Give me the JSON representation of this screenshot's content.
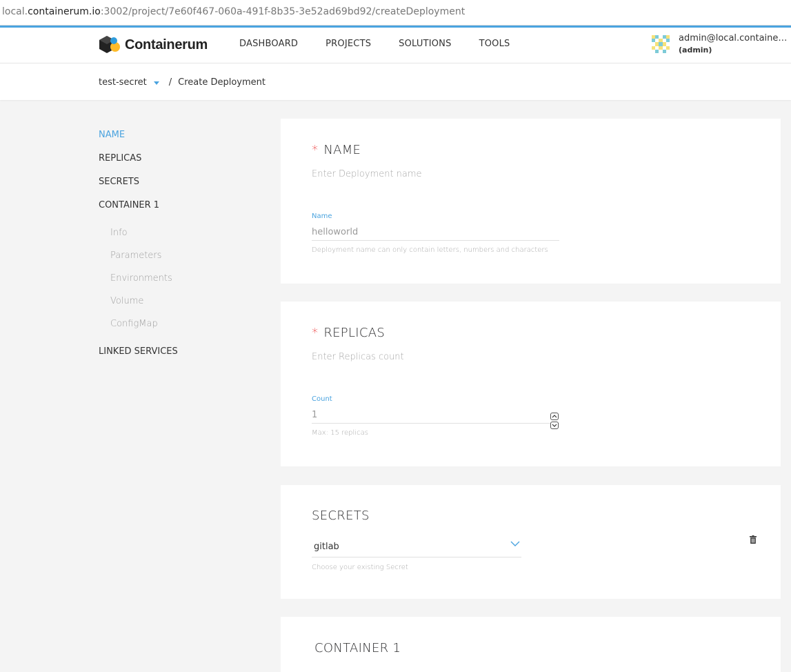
{
  "browser": {
    "url_prefix": "local.",
    "url_host": "containerum.io",
    "url_path": ":3002/project/7e60f467-060a-491f-8b35-3e52ad69bd92/createDeployment"
  },
  "header": {
    "logo_text": "Containerum",
    "nav": [
      "DASHBOARD",
      "PROJECTS",
      "SOLUTIONS",
      "TOOLS"
    ],
    "user_email": "admin@local.containerum.io",
    "user_role": "(admin)"
  },
  "breadcrumb": {
    "project": "test-secret",
    "separator": "/",
    "current": "Create Deployment"
  },
  "sidebar": {
    "items": [
      "NAME",
      "REPLICAS",
      "SECRETS",
      "CONTAINER 1"
    ],
    "container_sub": [
      "Info",
      "Parameters",
      "Environments",
      "Volume",
      "ConfigMap"
    ],
    "linked": "LINKED SERVICES",
    "active": "NAME"
  },
  "name_card": {
    "title": "NAME",
    "subtitle": "Enter Deployment name",
    "field_label": "Name",
    "field_value": "helloworld",
    "help": "Deployment name can only contain letters, numbers and characters"
  },
  "replicas_card": {
    "title": "REPLICAS",
    "subtitle": "Enter Replicas count",
    "field_label": "Count",
    "field_value": "1",
    "help": "Max: 15 replicas"
  },
  "secrets_card": {
    "title": "SECRETS",
    "selected": "gitlab",
    "help": "Choose your existing Secret"
  },
  "container_card": {
    "title": "CONTAINER 1"
  },
  "colors": {
    "accent": "#4aa3df",
    "required": "#ec3d3d",
    "background": "#f4f4f4"
  },
  "icons": {
    "logo": "hexagon-cube-logo",
    "avatar": "pixel-identicon",
    "caret": "caret-down-icon",
    "select": "chevron-down-icon",
    "delete": "trash-icon",
    "stepper_up": "chevron-up-icon",
    "stepper_down": "chevron-down-icon"
  }
}
